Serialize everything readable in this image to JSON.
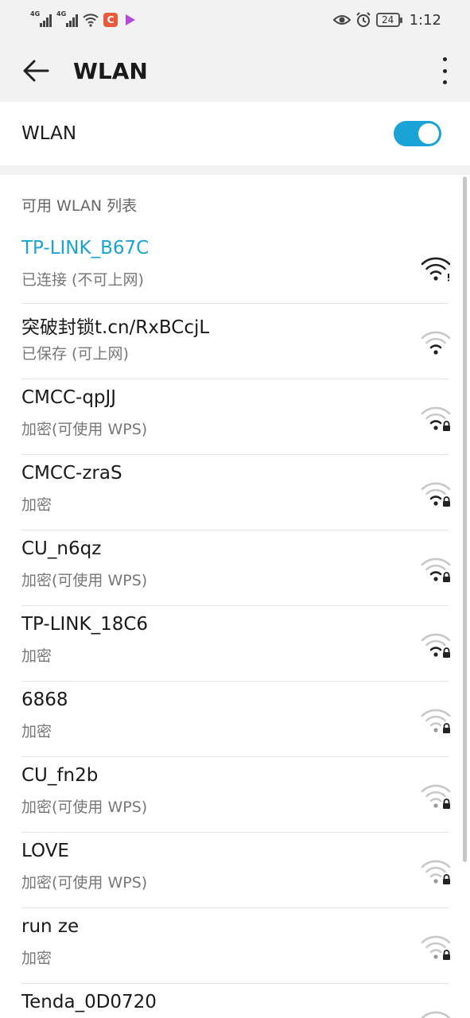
{
  "status_bar": {
    "sim1_tag": "4G",
    "sim2_tag": "4G",
    "app_badge": "C",
    "battery": "24",
    "time": "1:12",
    "icons": [
      "signal-icon",
      "signal-icon",
      "wifi-icon",
      "app-icon",
      "video-icon",
      "eye-icon",
      "alarm-icon",
      "battery-icon"
    ]
  },
  "app_bar": {
    "title": "WLAN",
    "back_icon": "arrow-left-icon",
    "more_icon": "more-vert-icon"
  },
  "toggle": {
    "label": "WLAN",
    "on": true
  },
  "list": {
    "header": "可用 WLAN 列表",
    "items": [
      {
        "ssid": "TP-LINK_B67C",
        "status": "已连接 (不可上网)",
        "connected": true,
        "signal": 3,
        "locked": false,
        "alert": true
      },
      {
        "ssid": "突破封锁t.cn/RxBCcjL",
        "status": "已保存 (可上网)",
        "connected": false,
        "signal": 1,
        "locked": false,
        "alert": false
      },
      {
        "ssid": "CMCC-qpJJ",
        "status": "加密(可使用 WPS)",
        "connected": false,
        "signal": 1,
        "locked": true,
        "alert": false
      },
      {
        "ssid": "CMCC-zraS",
        "status": "加密",
        "connected": false,
        "signal": 1,
        "locked": true,
        "alert": false
      },
      {
        "ssid": "CU_n6qz",
        "status": "加密(可使用 WPS)",
        "connected": false,
        "signal": 1,
        "locked": true,
        "alert": false
      },
      {
        "ssid": "TP-LINK_18C6",
        "status": "加密",
        "connected": false,
        "signal": 1,
        "locked": true,
        "alert": false
      },
      {
        "ssid": "6868",
        "status": "加密",
        "connected": false,
        "signal": 0,
        "locked": true,
        "alert": false
      },
      {
        "ssid": "CU_fn2b",
        "status": "加密(可使用 WPS)",
        "connected": false,
        "signal": 0,
        "locked": true,
        "alert": false
      },
      {
        "ssid": "LOVE",
        "status": "加密(可使用 WPS)",
        "connected": false,
        "signal": 0,
        "locked": true,
        "alert": false
      },
      {
        "ssid": "run ze",
        "status": "加密",
        "connected": false,
        "signal": 0,
        "locked": true,
        "alert": false
      },
      {
        "ssid": "Tenda_0D0720",
        "status": "",
        "connected": false,
        "signal": 0,
        "locked": true,
        "alert": false
      }
    ]
  },
  "colors": {
    "accent": "#1aa3d6",
    "background": "#f2f2f2",
    "card": "#ffffff",
    "secondary_text": "#777777"
  }
}
